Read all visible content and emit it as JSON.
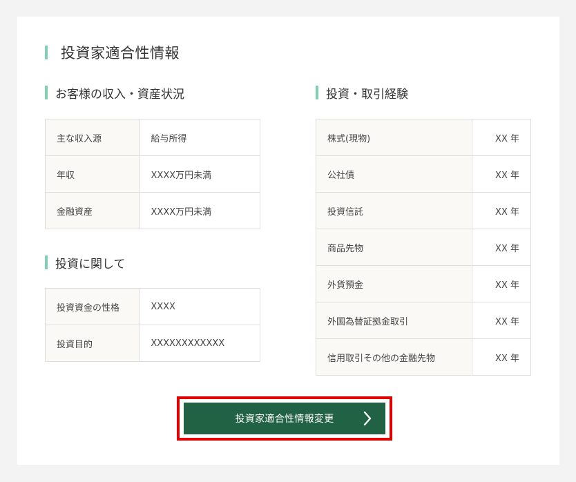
{
  "page": {
    "title": "投資家適合性情報"
  },
  "income_section": {
    "title": "お客様の収入・資産状況",
    "rows": [
      {
        "label": "主な収入源",
        "value": "給与所得"
      },
      {
        "label": "年収",
        "value": "XXXX万円未満"
      },
      {
        "label": "金融資産",
        "value": "XXXX万円未満"
      }
    ]
  },
  "investment_section": {
    "title": "投資に関して",
    "rows": [
      {
        "label": "投資資金の性格",
        "value": "XXXX"
      },
      {
        "label": "投資目的",
        "value": "XXXXXXXXXXXX"
      }
    ]
  },
  "experience_section": {
    "title": "投資・取引経験",
    "rows": [
      {
        "label": "株式(現物)",
        "value": "XX 年"
      },
      {
        "label": "公社債",
        "value": "XX 年"
      },
      {
        "label": "投資信託",
        "value": "XX 年"
      },
      {
        "label": "商品先物",
        "value": "XX 年"
      },
      {
        "label": "外貨預金",
        "value": "XX 年"
      },
      {
        "label": "外国為替証拠金取引",
        "value": "XX 年"
      },
      {
        "label": "信用取引その他の金融先物",
        "value": "XX 年"
      }
    ]
  },
  "change_button": {
    "label": "投資家適合性情報変更",
    "icon": "chevron-right-icon"
  },
  "colors": {
    "accent_bar": "#7fcfb3",
    "button_bg": "#216245",
    "highlight_border": "#e00000",
    "label_bg": "#faf9f5"
  }
}
